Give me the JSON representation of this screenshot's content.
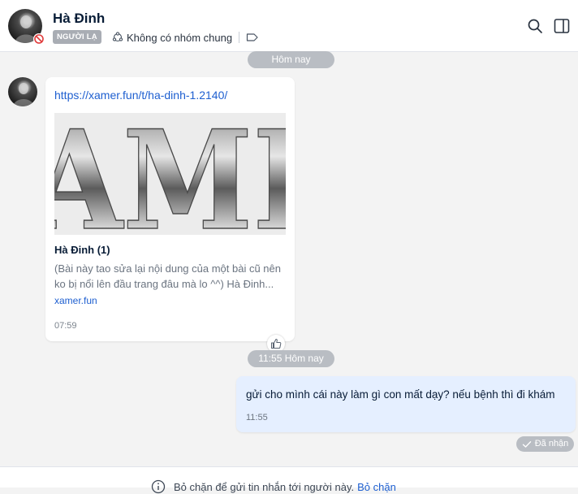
{
  "header": {
    "contact_name": "Hà Đinh",
    "stranger_tag": "NGƯỜI LẠ",
    "groups_text": "Không có nhóm chung",
    "icons": [
      "avatar",
      "blocked-icon",
      "group-icon",
      "tag-icon",
      "search-icon",
      "sidebar-toggle-icon"
    ]
  },
  "conversation": {
    "date_separator_1": "Hôm nay",
    "link_card": {
      "url": "https://xamer.fun/t/ha-dinh-1.2140/",
      "preview_text": "AMI",
      "title": "Hà Đinh (1)",
      "description": "(Bài này tao sửa lại nội dung của một bài cũ nên ko bị nổi lên đầu trang đâu mà lo ^^) Hà Đinh...",
      "domain": "xamer.fun",
      "time": "07:59"
    },
    "date_separator_2": "11:55 Hôm nay",
    "outgoing": {
      "text": "gửi cho mình cái này làm gì con mất dạy? nếu bệnh thì đi khám",
      "time": "11:55",
      "status": "Đã nhận"
    }
  },
  "footer": {
    "notice": "Bỏ chặn để gửi tin nhắn tới người này.",
    "unblock_label": "Bỏ chặn"
  },
  "colors": {
    "accent": "#1e5fd0",
    "outgoing_bubble": "#e5efff",
    "pill": "#b9bdc3",
    "background": "#f3f3f3",
    "blocked": "#e03b3b"
  }
}
